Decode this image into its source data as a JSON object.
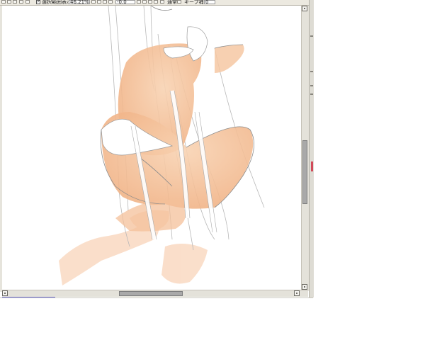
{
  "toolbar": {
    "checkbox_label": "選択範囲表示",
    "zoom": "46.21%",
    "angle": "-0.0",
    "blend_label": "通常",
    "fill_label": "キープ補正",
    "fill_value": "0"
  },
  "colors": {
    "canvas": "#ffffff",
    "skin": "#f6c7a0",
    "line_art": "#9a9a9a",
    "scroll_track": "#e4e2da",
    "scroll_thumb": "#a9a9a9",
    "panel_accent": "#d14a5a"
  },
  "scroll": {
    "vertical_fraction": 0.48,
    "horizontal_fraction": 0.39
  }
}
